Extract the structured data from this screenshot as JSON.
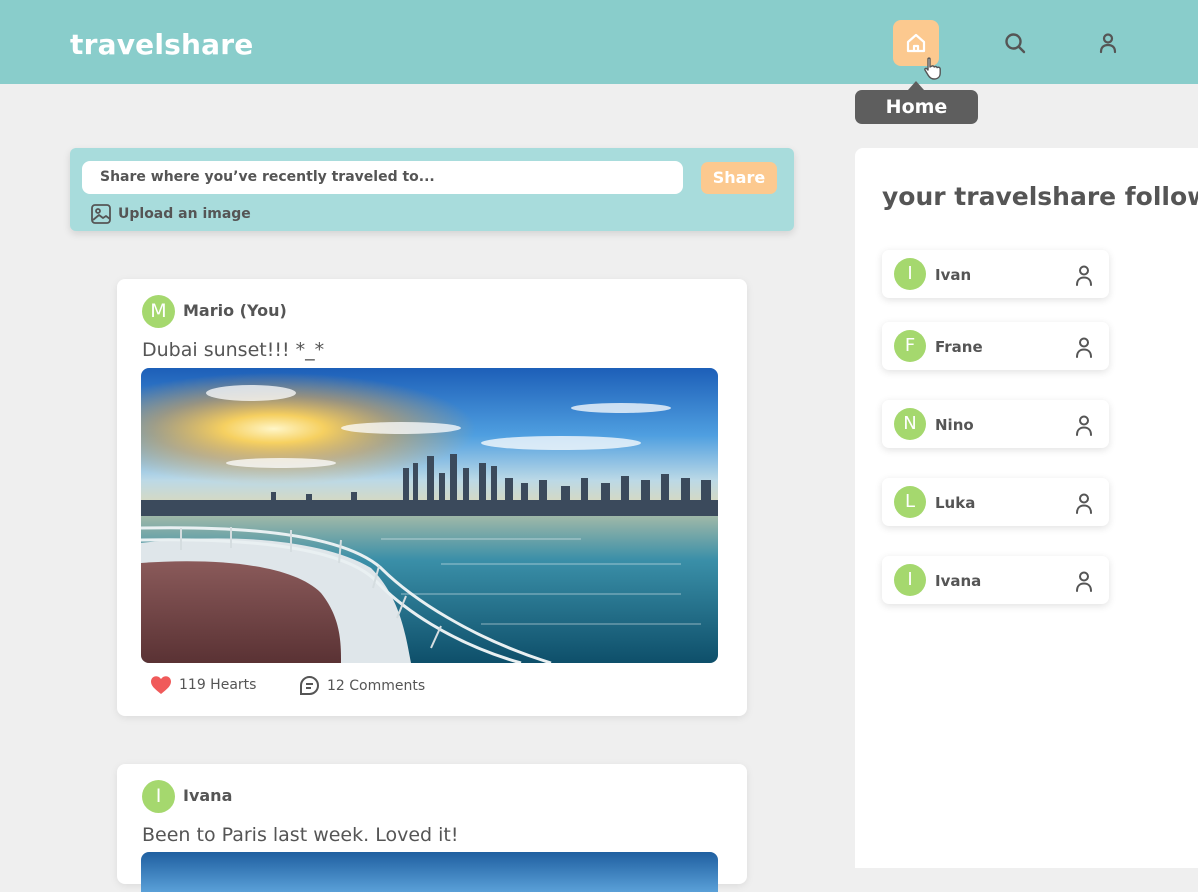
{
  "app": {
    "logo": "travelshare"
  },
  "nav": {
    "items": [
      {
        "name": "home",
        "icon": "home-icon",
        "active": true
      },
      {
        "name": "search",
        "icon": "search-icon"
      },
      {
        "name": "profile",
        "icon": "user-icon"
      }
    ],
    "tooltip": "Home"
  },
  "composer": {
    "placeholder": "Share where you’ve recently traveled to...",
    "share_label": "Share",
    "upload_label": "Upload an image"
  },
  "posts": [
    {
      "avatar_letter": "M",
      "author": "Mario (You)",
      "text": "Dubai sunset!!! *_*",
      "image": "dubai-skyline-sunset",
      "hearts": "119 Hearts",
      "comments": "12 Comments"
    },
    {
      "avatar_letter": "I",
      "author": "Ivana",
      "text": "Been to Paris last week. Loved it!"
    }
  ],
  "follows": {
    "title": "your travelshare follows",
    "items": [
      {
        "letter": "I",
        "name": "Ivan"
      },
      {
        "letter": "F",
        "name": "Frane"
      },
      {
        "letter": "N",
        "name": "Nino"
      },
      {
        "letter": "L",
        "name": "Luka"
      },
      {
        "letter": "I",
        "name": "Ivana"
      }
    ]
  },
  "colors": {
    "header": "#89cdcb",
    "composer": "#a8dcdc",
    "accent": "#fcc98f",
    "avatar": "#a5d86e",
    "heart": "#f05a5a"
  }
}
